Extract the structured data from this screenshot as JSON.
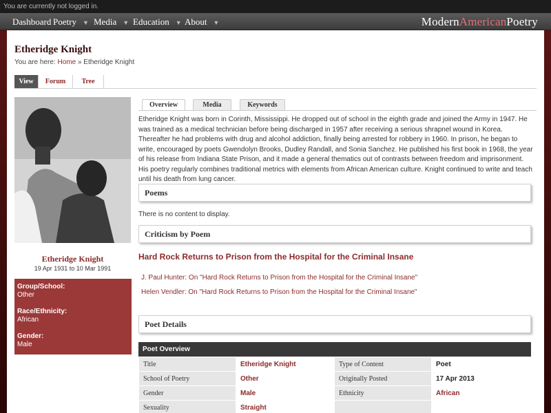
{
  "topbar": {
    "status": "You are currently not logged in."
  },
  "nav": {
    "items": [
      {
        "label": "Dashboard",
        "has_menu": false
      },
      {
        "label": "Poetry",
        "has_menu": true
      },
      {
        "label": "Media",
        "has_menu": true
      },
      {
        "label": "Education",
        "has_menu": true
      },
      {
        "label": "About",
        "has_menu": true
      }
    ],
    "caret": "▼",
    "brand_part1": "Modern",
    "brand_part2": "American",
    "brand_part3": "Poetry"
  },
  "page": {
    "title": "Etheridge Knight",
    "breadcrumb_prefix": "You are here:",
    "breadcrumb_home": "Home",
    "breadcrumb_sep": "»",
    "breadcrumb_current": "Etheridge Knight",
    "tabs": [
      {
        "label": "View",
        "active": true
      },
      {
        "label": "Forum",
        "active": false
      },
      {
        "label": "Tree",
        "active": false
      }
    ]
  },
  "sidebar": {
    "photo_icon": "portrait-photo",
    "name": "Etheridge Knight",
    "dates": "19 Apr 1931 to 10 Mar 1991",
    "info": [
      {
        "label": "Group/School:",
        "value": "Other"
      },
      {
        "label": "Race/Ethnicity:",
        "value": "African"
      },
      {
        "label": "Gender:",
        "value": "Male"
      }
    ]
  },
  "content_tabs": [
    {
      "label": "Overview",
      "active": true
    },
    {
      "label": "Media",
      "active": false
    },
    {
      "label": "Keywords",
      "active": false
    }
  ],
  "overview": "Etheridge Knight was born in Corinth, Mississippi. He dropped out of school in the eighth grade and joined the Army in 1947. He was trained as a medical technician before being discharged in 1957 after receiving a serious shrapnel wound in Korea. Thereafter he had problems with drug and alcohol addiction, finally being arrested for robbery in 1960. In prison, he began to write, encouraged by poets Gwendolyn Brooks, Dudley Randall, and Sonia Sanchez. He published his first book in 1968, the year of his release from Indiana State Prison, and it made a general thematics out of contrasts between freedom and imprisonment. His poetry regularly combines traditional metrics with elements from African American culture. Knight continued to write and teach until his death from lung cancer.",
  "poems": {
    "heading": "Poems",
    "empty_text": "There is no content to display."
  },
  "criticism": {
    "heading": "Criticism by Poem",
    "poem_title": "Hard Rock Returns to Prison from the Hospital for the Criminal Insane",
    "links": [
      "J. Paul Hunter: On \"Hard Rock Returns to Prison from the Hospital for the Criminal Insane\"",
      "Helen Vendler: On \"Hard Rock Returns to Prison from the Hospital for the Criminal Insane\""
    ]
  },
  "details": {
    "heading": "Poet Details",
    "table_title": "Poet Overview",
    "rows": [
      {
        "l1": "Title",
        "v1": "Etheridge Knight",
        "l2": "Type of Content",
        "v2": "Poet"
      },
      {
        "l1": "School of Poetry",
        "v1": "Other",
        "l2": "Originally Posted",
        "v2": "17 Apr 2013"
      },
      {
        "l1": "Gender",
        "v1": "Male",
        "l2": "Ethnicity",
        "v2": "African"
      },
      {
        "l1": "Sexuality",
        "v1": "Straight",
        "l2": "",
        "v2": ""
      }
    ]
  }
}
